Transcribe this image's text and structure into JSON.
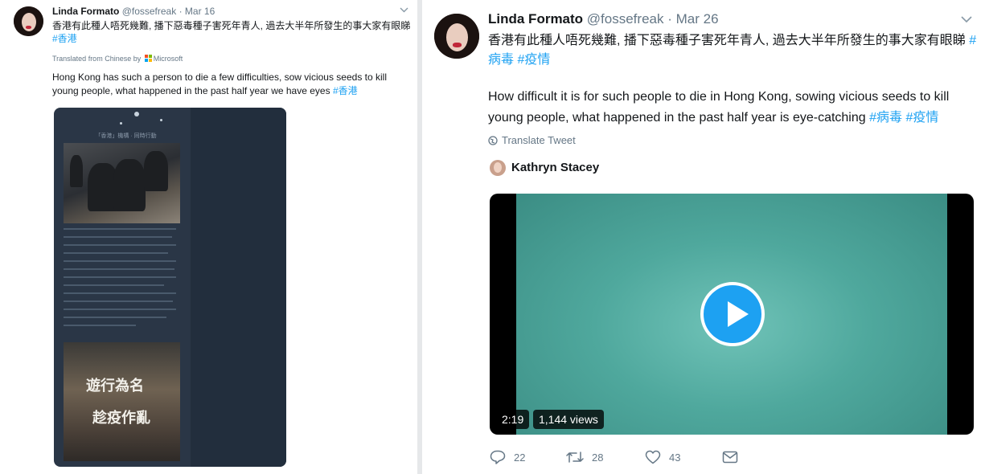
{
  "left_tweet": {
    "author_name": "Linda Formato",
    "handle": "@fossefreak",
    "separator": "·",
    "date": "Mar 16",
    "text_chinese": "香港有此種人唔死幾難, 播下惡毒種子害死年青人, 過去大半年所發生的事大家有眼睇",
    "hashtag": "#香港",
    "translated_label": "Translated from Chinese by",
    "translator": "Microsoft",
    "text_english": "Hong Kong has such a person to die a few difficulties, sow vicious seeds to kill young people, what happened in the past half year we have eyes",
    "image": {
      "caption": "「香港」機構 · 同時行動",
      "poster_line1": "遊行為名",
      "poster_line2": "趁疫作亂"
    }
  },
  "right_tweet": {
    "author_name": "Linda Formato",
    "handle": "@fossefreak",
    "separator": "·",
    "date": "Mar 26",
    "text_chinese": "香港有此種人唔死幾難, 播下惡毒種子害死年青人, 過去大半年所發生的事大家有眼睇",
    "hashtags_chinese": "#病毒 #疫情",
    "text_english": "How difficult it is for such people to die in Hong Kong, sowing vicious seeds to kill young people, what happened in the past half year is eye-catching",
    "hashtags_english": "#病毒 #疫情",
    "translate_label": "Translate Tweet",
    "quoted_user": "Kathryn Stacey",
    "video": {
      "duration": "2:19",
      "views": "1,144 views"
    },
    "actions": {
      "replies": "22",
      "retweets": "28",
      "likes": "43"
    }
  },
  "icons": [
    "chevron-down-icon",
    "microsoft-logo-icon",
    "globe-icon",
    "play-icon",
    "reply-icon",
    "retweet-icon",
    "like-icon",
    "direct-message-icon"
  ],
  "colors": {
    "link": "#1da1f2",
    "secondary_text": "#657786",
    "video_tint": "#4fa89d"
  }
}
